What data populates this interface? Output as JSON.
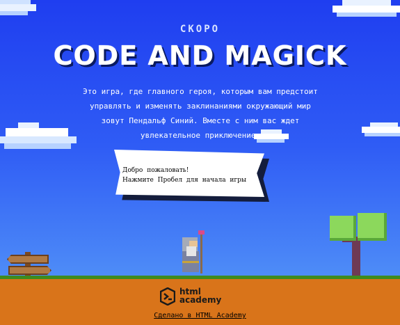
{
  "header": {
    "soon": "СКОРО",
    "title": "CODE AND MAGICK"
  },
  "description": {
    "line1": "Это игра, где главного героя, которым вам предстоит",
    "line2": "управлять и изменять заклинаниями окружающий мир",
    "line3": "зовут Пендальф Синий. Вместе с ним вас ждет",
    "line4": "увлекательное приключение…"
  },
  "dialog": {
    "line1": "Добро пожаловать!",
    "line2": "Нажмите Пробел для начала игры"
  },
  "footer": {
    "logo_line1": "html",
    "logo_line2": "academy",
    "made_by": "Сделано в HTML Academy"
  },
  "colors": {
    "sky_top": "#1f3ef0",
    "sky_bottom": "#5aa2f7",
    "ground": "#d9741a",
    "grass": "#3e8b1e"
  },
  "icons": [
    "html-academy-logo-icon"
  ]
}
